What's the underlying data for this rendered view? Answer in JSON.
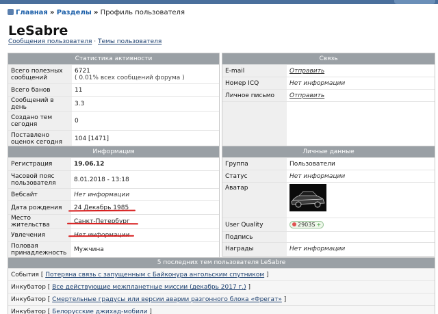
{
  "breadcrumb": {
    "home": "Главная",
    "sep1": "»",
    "sections": "Разделы",
    "sep2": "»",
    "current": "Профиль пользователя"
  },
  "profile": {
    "username": "LeSabre",
    "links": {
      "posts": "Сообщения пользователя",
      "sep": "·",
      "topics": "Темы пользователя"
    }
  },
  "stats": {
    "header": "Статистика активности",
    "rows": [
      {
        "label": "Всего полезных сообщений",
        "value": "6721",
        "note": "( 0.01% всех сообщений форума )"
      },
      {
        "label": "Всего банов",
        "value": "11"
      },
      {
        "label": "Сообщений в день",
        "value": "3.3"
      },
      {
        "label": "Создано тем сегодня",
        "value": "0"
      },
      {
        "label": "Поставлено оценок сегодня",
        "value": "104 [1471]"
      }
    ]
  },
  "contact": {
    "header": "Связь",
    "rows": [
      {
        "label": "E-mail",
        "value": "Отправить"
      },
      {
        "label": "Номер ICQ",
        "value": "Нет информации"
      },
      {
        "label": "Личное письмо",
        "value": "Отправить"
      }
    ]
  },
  "info": {
    "header": "Информация",
    "rows": [
      {
        "label": "Регистрация",
        "value": "19.06.12"
      },
      {
        "label": "Часовой пояс пользователя",
        "value": "8.01.2018 - 13:18"
      },
      {
        "label": "Вебсайт",
        "value": "Нет информации"
      },
      {
        "label": "Дата рождения",
        "value": "24 Декабрь 1985"
      },
      {
        "label": "Место жительства",
        "value": "Санкт-Петербург"
      },
      {
        "label": "Увлечения",
        "value": "Нет информации"
      },
      {
        "label": "Половая принадлежность",
        "value": "Мужчина"
      }
    ]
  },
  "personal": {
    "header": "Личные данные",
    "rows": [
      {
        "label": "Группа",
        "value": "Пользователи"
      },
      {
        "label": "Статус",
        "value": "Нет информации"
      },
      {
        "label": "Аватар",
        "value": ""
      },
      {
        "label": "User Quality",
        "value": "2903S",
        "suffix": "+"
      },
      {
        "label": "Подпись",
        "value": ""
      },
      {
        "label": "Награды",
        "value": "Нет информации"
      }
    ]
  },
  "topics": {
    "header": "5 последних тем пользователя LeSabre",
    "rows": [
      {
        "section": "События",
        "title": "Потеряна связь с запущенным с Байконура ангольским спутником"
      },
      {
        "section": "Инкубатор",
        "title": "Все действующие межпланетные миссии (декабрь 2017 г.)"
      },
      {
        "section": "Инкубатор",
        "title": "Смертельные градусы или версии аварии разгонного блока «Фрегат»"
      },
      {
        "section": "Инкубатор",
        "title": "Белорусские джихад-мобили"
      }
    ]
  },
  "colors": {
    "panel_header": "#9aa0a5",
    "label_bg": "#efefef",
    "link": "#1a5ea8",
    "underline_marker": "#d81e1e"
  }
}
